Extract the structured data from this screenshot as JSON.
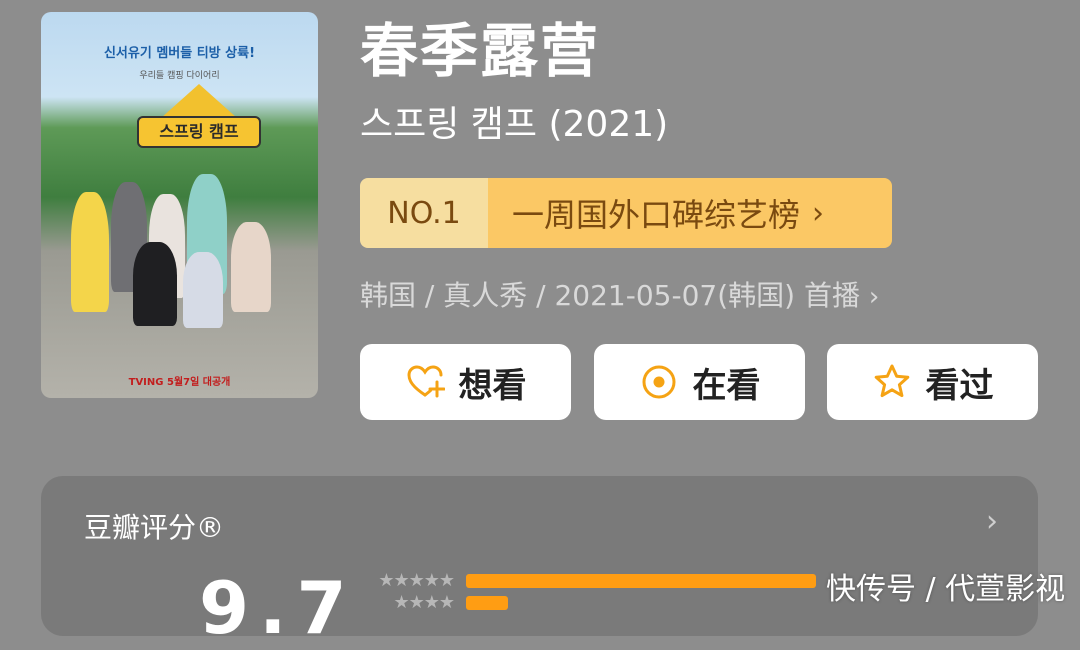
{
  "poster": {
    "headline": "신서유기 멤버들 티방 상륙!",
    "subline": "우리들 캠핑 다이어리",
    "logo": "스프링 캠프",
    "footer": "TVING 5월7일 대공개"
  },
  "header": {
    "title": "春季露营",
    "original_title": "스프링 캠프 (2021)"
  },
  "rank": {
    "number": "NO.1",
    "label": "一周国外口碑综艺榜",
    "chevron": "›",
    "colors": {
      "number_bg": "#f6dea0",
      "label_bg": "#fbc865",
      "text": "#7a4a10"
    }
  },
  "meta": {
    "text": "韩国 / 真人秀 / 2021-05-07(韩国) 首播",
    "chevron": "›"
  },
  "actions": [
    {
      "label": "想看",
      "icon": "heart-plus-icon"
    },
    {
      "label": "在看",
      "icon": "target-circle-icon"
    },
    {
      "label": "看过",
      "icon": "star-outline-icon"
    }
  ],
  "rating": {
    "label": "豆瓣评分®",
    "chevron": "›",
    "score": "9.7",
    "distribution": [
      {
        "stars": "★★★★★",
        "fraction": 0.92
      },
      {
        "stars": "★★★★",
        "fraction": 0.11
      }
    ],
    "bar_color": "#ff9d13"
  },
  "watermark": "快传号 / 代萱影视"
}
